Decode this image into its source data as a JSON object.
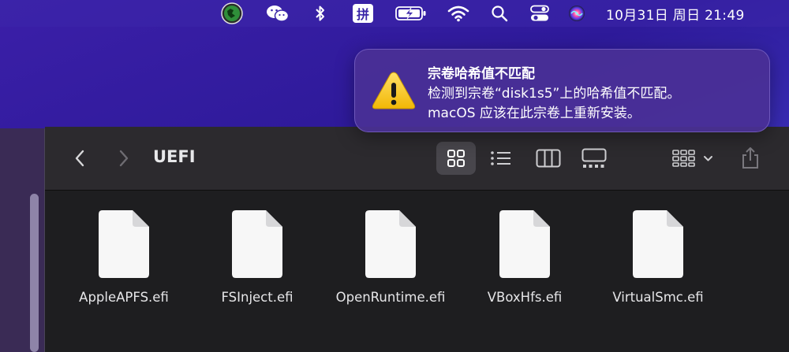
{
  "menubar": {
    "icons": [
      "status-globe-icon",
      "wechat-icon",
      "bluetooth-icon",
      "input-method-icon",
      "battery-charging-icon",
      "wifi-icon",
      "spotlight-search-icon",
      "control-center-icon",
      "siri-icon"
    ],
    "input_method_label": "拼",
    "clock": "10月31日 周日  21:49"
  },
  "notification": {
    "icon": "warning-icon",
    "title": "宗卷哈希值不匹配",
    "line1": "检测到宗卷“disk1s5”上的哈希值不匹配。",
    "line2": "macOS 应该在此宗卷上重新安装。",
    "accent_color": "#f5c518"
  },
  "finder": {
    "title": "UEFI",
    "toolbar_icons": [
      "back-chevron-icon",
      "forward-chevron-icon",
      "icon-view-icon",
      "list-view-icon",
      "column-view-icon",
      "gallery-view-icon",
      "group-by-icon",
      "share-icon"
    ],
    "selected_view": "icon-view",
    "files": [
      {
        "name": "AppleAPFS.efi"
      },
      {
        "name": "FSInject.efi"
      },
      {
        "name": "OpenRuntime.efi"
      },
      {
        "name": "VBoxHfs.efi"
      },
      {
        "name": "VirtualSmc.efi"
      }
    ]
  }
}
